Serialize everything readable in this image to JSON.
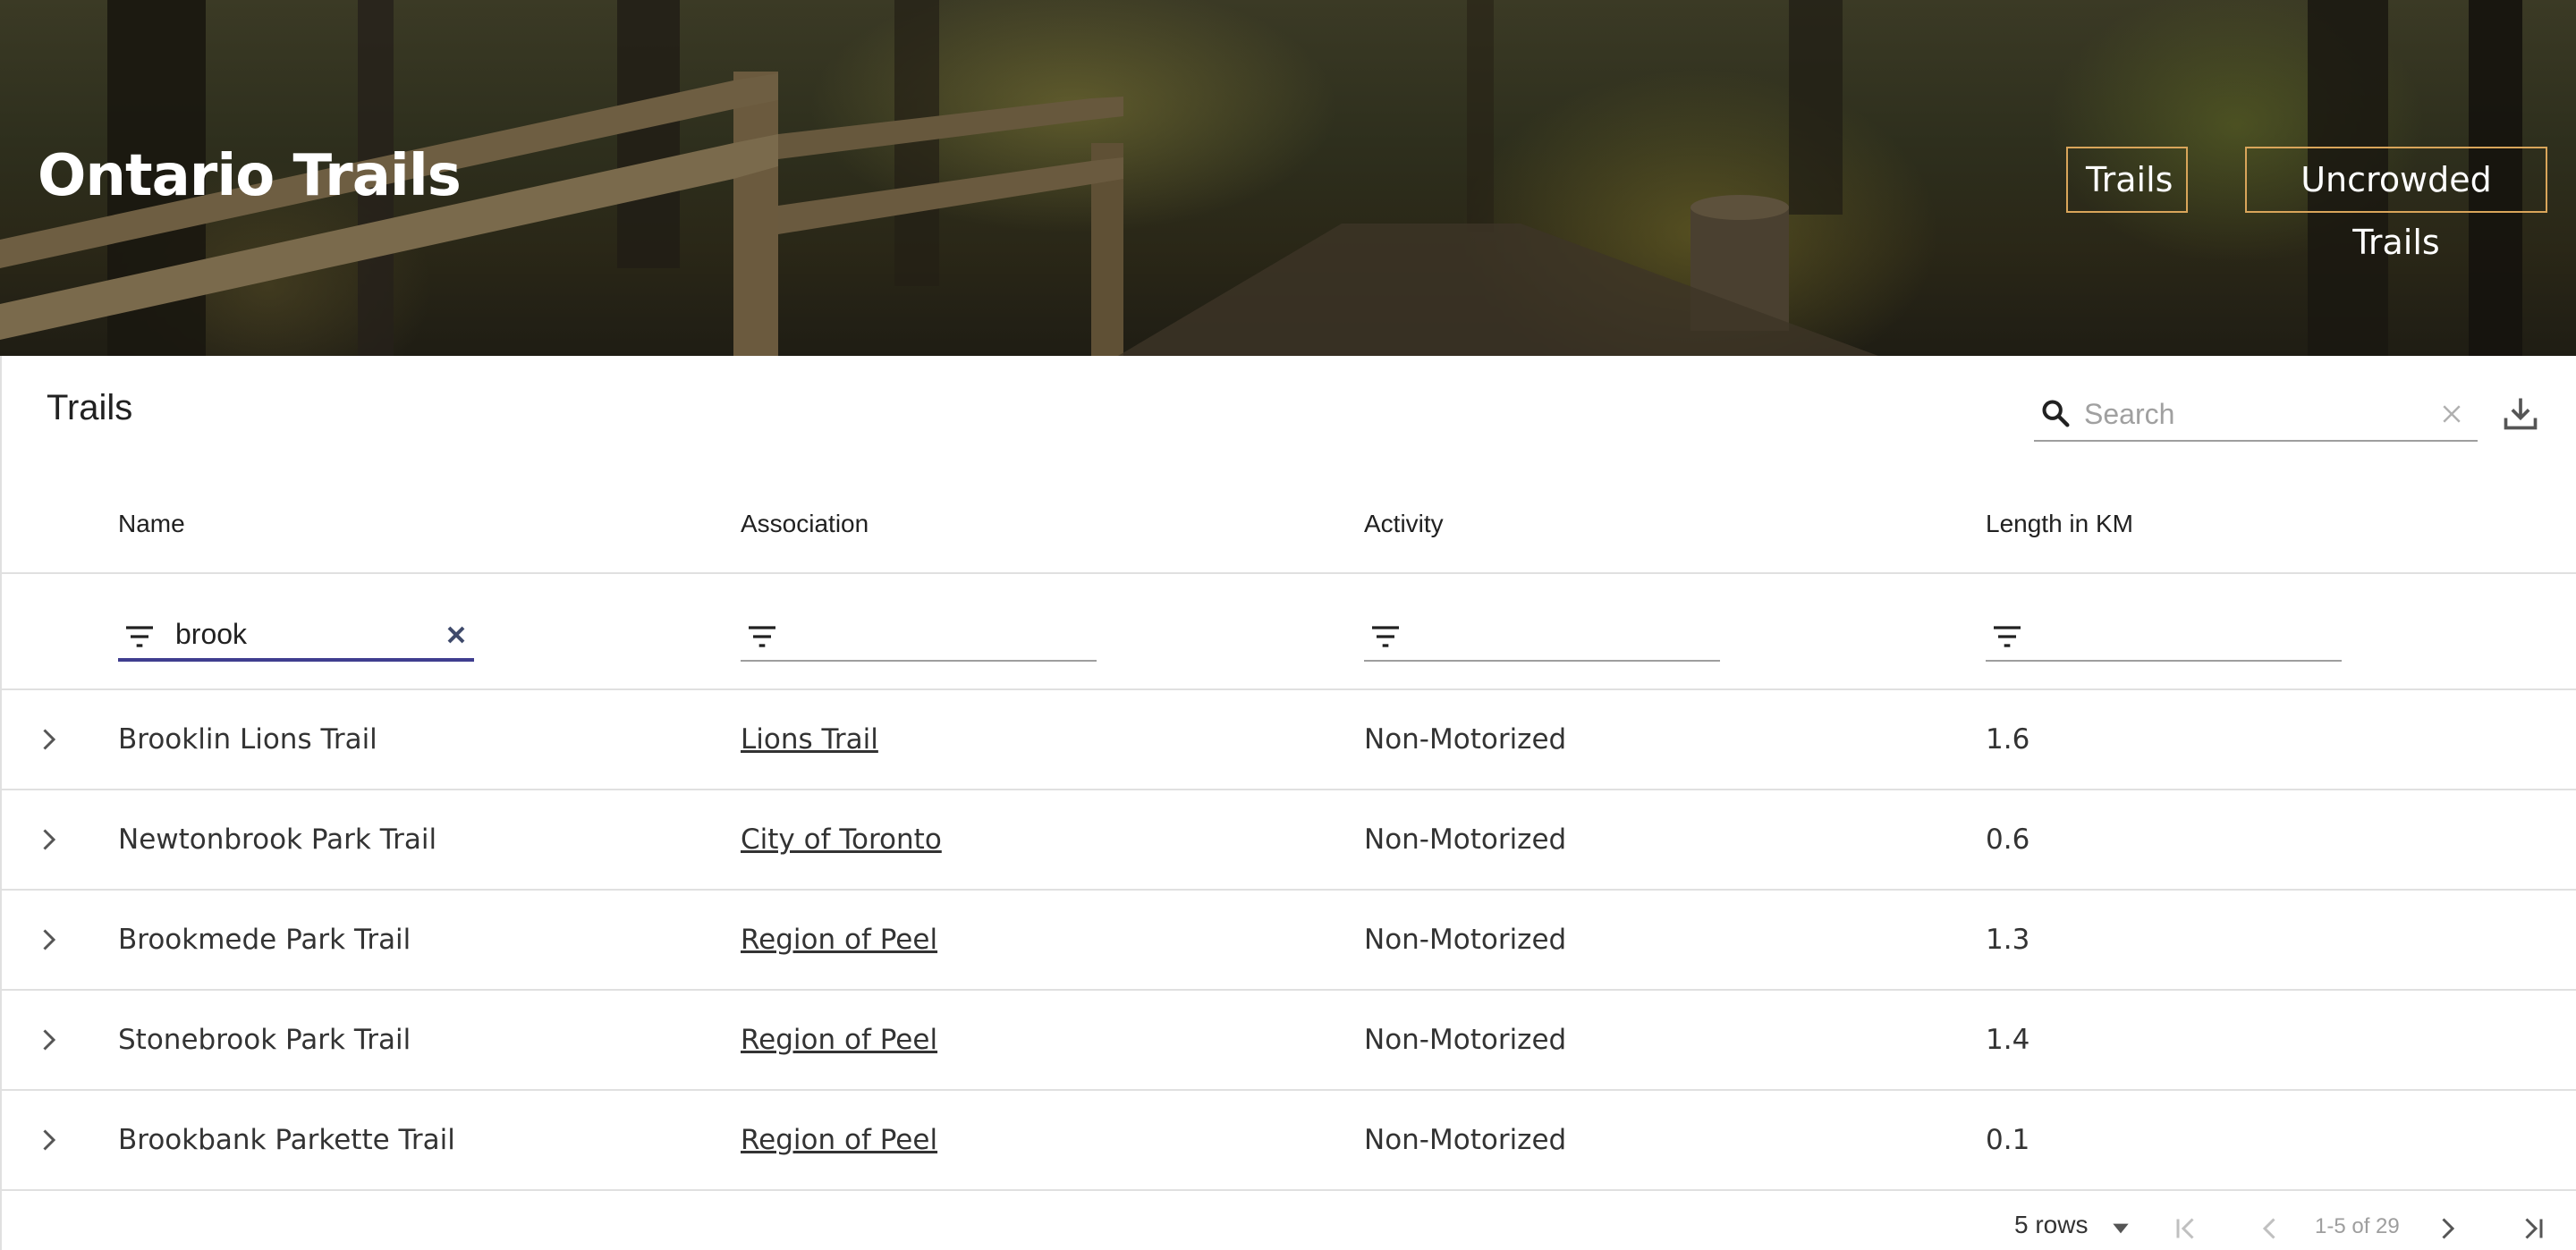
{
  "site": {
    "title": "Ontario Trails",
    "nav": [
      {
        "label": "Trails"
      },
      {
        "label": "Uncrowded Trails"
      }
    ]
  },
  "table": {
    "title": "Trails",
    "search": {
      "placeholder": "Search",
      "value": ""
    },
    "columns": [
      {
        "label": "Name",
        "filter_value": "brook"
      },
      {
        "label": "Association",
        "filter_value": ""
      },
      {
        "label": "Activity",
        "filter_value": ""
      },
      {
        "label": "Length in KM",
        "filter_value": ""
      }
    ],
    "rows": [
      {
        "name": "Brooklin Lions Trail",
        "association": "Lions Trail",
        "activity": "Non-Motorized",
        "length": "1.6"
      },
      {
        "name": "Newtonbrook Park Trail",
        "association": "City of Toronto",
        "activity": "Non-Motorized",
        "length": "0.6"
      },
      {
        "name": "Brookmede Park Trail",
        "association": "Region of Peel",
        "activity": "Non-Motorized",
        "length": "1.3"
      },
      {
        "name": "Stonebrook Park Trail",
        "association": "Region of Peel",
        "activity": "Non-Motorized",
        "length": "1.4"
      },
      {
        "name": "Brookbank Parkette Trail",
        "association": "Region of Peel",
        "activity": "Non-Motorized",
        "length": "0.1"
      }
    ],
    "pagination": {
      "rows_per_page": "5 rows",
      "range": "1-5 of 29"
    }
  },
  "icons": {
    "search": "search-icon",
    "clear_search": "close-icon",
    "download": "download-icon",
    "filter": "filter-icon",
    "clear_filter": "close-icon",
    "expand": "chevron-right-icon",
    "first_page": "first-page-icon",
    "prev_page": "chevron-left-icon",
    "next_page": "chevron-right-icon",
    "last_page": "last-page-icon",
    "dropdown": "arrow-drop-down-icon"
  },
  "colors": {
    "nav_border": "#d9a55a",
    "active_filter_underline": "#3f3d8f",
    "divider": "#e0e0e0"
  }
}
